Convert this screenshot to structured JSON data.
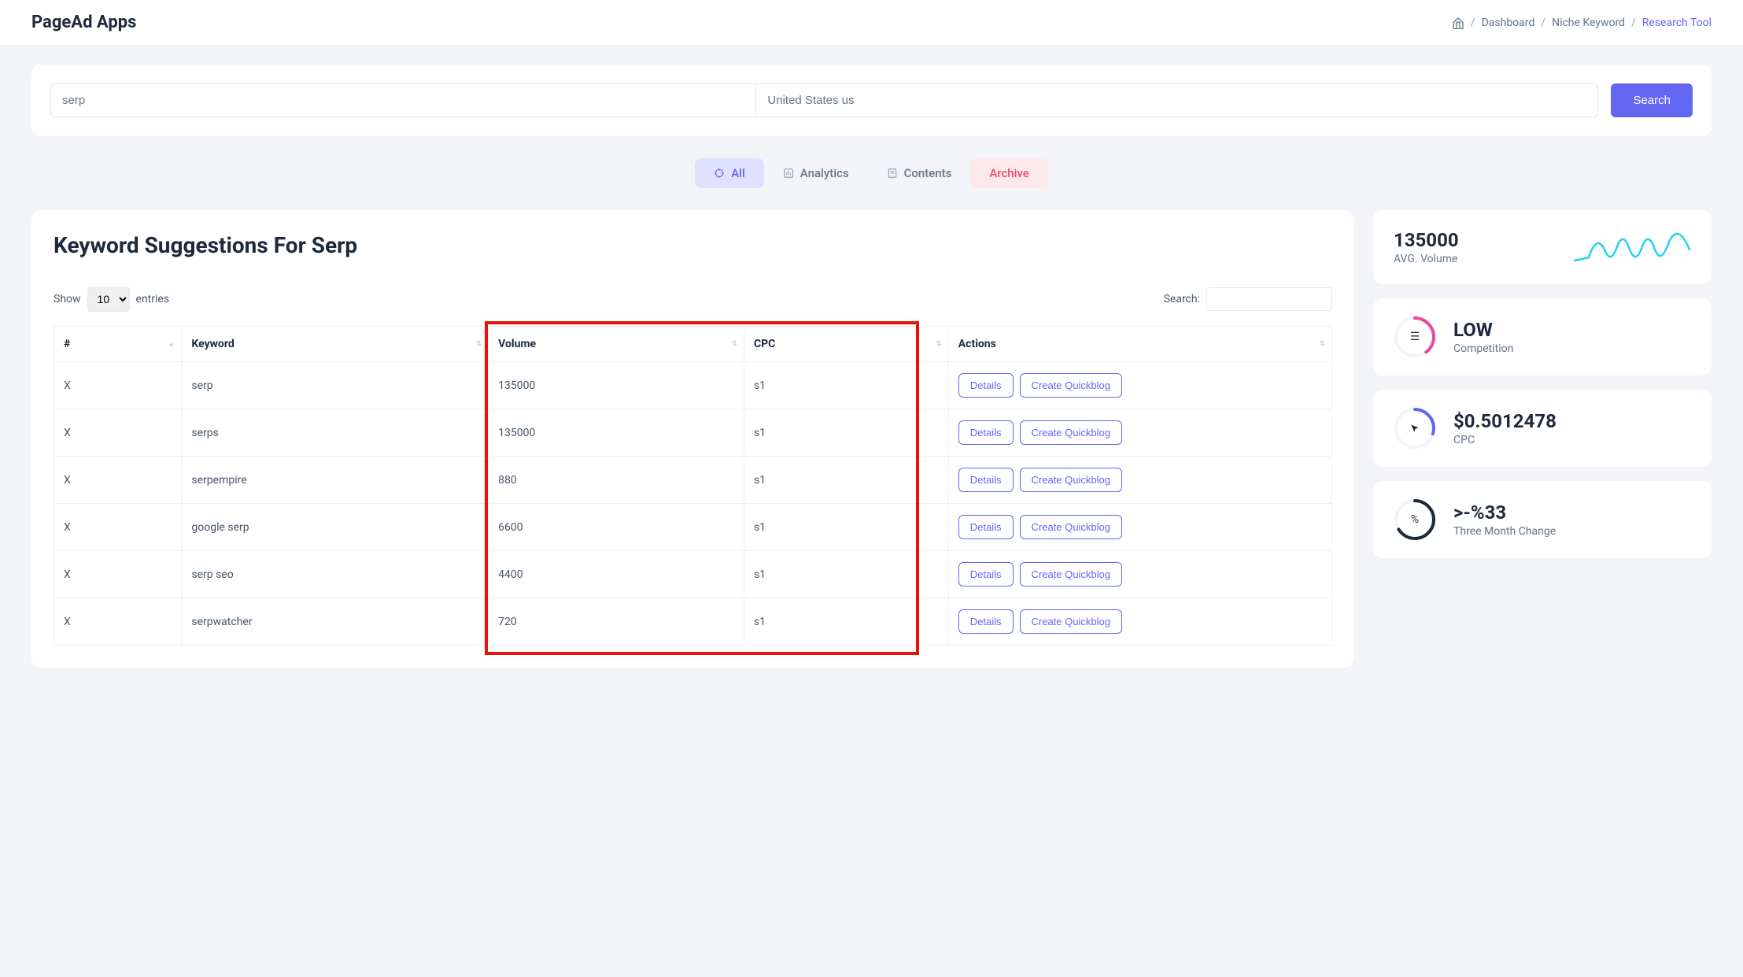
{
  "app_title": "PageAd Apps",
  "breadcrumb": {
    "items": [
      "Dashboard",
      "Niche Keyword",
      "Research Tool"
    ]
  },
  "search": {
    "keyword_value": "serp",
    "country_value": "United States us",
    "button_label": "Search"
  },
  "tabs": [
    {
      "label": "All",
      "active": true
    },
    {
      "label": "Analytics",
      "active": false
    },
    {
      "label": "Contents",
      "active": false
    },
    {
      "label": "Archive",
      "active": false
    }
  ],
  "card_title": "Keyword Suggestions For Serp",
  "table": {
    "show_label_pre": "Show",
    "show_label_post": "entries",
    "show_value": "10",
    "search_label": "Search:",
    "search_value": "",
    "columns": [
      "#",
      "Keyword",
      "Volume",
      "CPC",
      "Actions"
    ],
    "action_details": "Details",
    "action_create": "Create Quickblog",
    "rows": [
      {
        "x": "X",
        "keyword": "serp",
        "volume": "135000",
        "cpc": "s1"
      },
      {
        "x": "X",
        "keyword": "serps",
        "volume": "135000",
        "cpc": "s1"
      },
      {
        "x": "X",
        "keyword": "serpempire",
        "volume": "880",
        "cpc": "s1"
      },
      {
        "x": "X",
        "keyword": "google serp",
        "volume": "6600",
        "cpc": "s1"
      },
      {
        "x": "X",
        "keyword": "serp seo",
        "volume": "4400",
        "cpc": "s1"
      },
      {
        "x": "X",
        "keyword": "serpwatcher",
        "volume": "720",
        "cpc": "s1"
      }
    ]
  },
  "stats": {
    "volume": {
      "value": "135000",
      "label": "AVG. Volume"
    },
    "competition": {
      "value": "LOW",
      "label": "Competition"
    },
    "cpc": {
      "value": "$0.5012478",
      "label": "CPC"
    },
    "change": {
      "value": ">-%33",
      "label": "Three Month Change"
    }
  }
}
